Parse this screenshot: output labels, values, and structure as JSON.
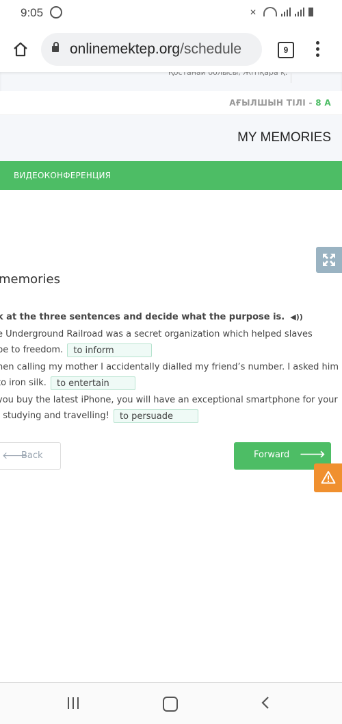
{
  "status_bar": {
    "time": "9:05",
    "icons": [
      "whatsapp-icon",
      "mute-icon",
      "wifi-icon",
      "signal-icon",
      "signal-icon",
      "battery-icon"
    ]
  },
  "browser": {
    "url_domain": "onlinemektep.org",
    "url_path": "/schedule",
    "tab_count": "9"
  },
  "page": {
    "region_text": "Қостанай облысы, Жітіқара қ.",
    "subject": "АҒЫЛШЫН ТІЛІ - ",
    "grade": "8 А",
    "lesson_header": "MY MEMORIES",
    "videoconference_label": "ВИДЕОКОНФЕРЕНЦИЯ",
    "lesson_title": "memories",
    "instruction": "k at the three sentences and decide what the purpose is.",
    "sentences": [
      {
        "line1": "e Underground Railroad was a secret organization which helped slaves",
        "line2": "pe to freedom.",
        "answer": "to inform"
      },
      {
        "line1": "hen calling my mother I accidentally dialled my friend’s number. I asked him",
        "line2": "to iron silk.",
        "answer": "to entertain"
      },
      {
        "line1": "you buy the latest iPhone, you will have an exceptional smartphone for your",
        "line2": ", studying and travelling!",
        "answer": "to persuade"
      }
    ],
    "back_label": "Back",
    "forward_label": "Forward"
  },
  "colors": {
    "brand_green": "#4dbd65",
    "warning_orange": "#f0902f",
    "expand_gray_blue": "#9ab3c2"
  }
}
